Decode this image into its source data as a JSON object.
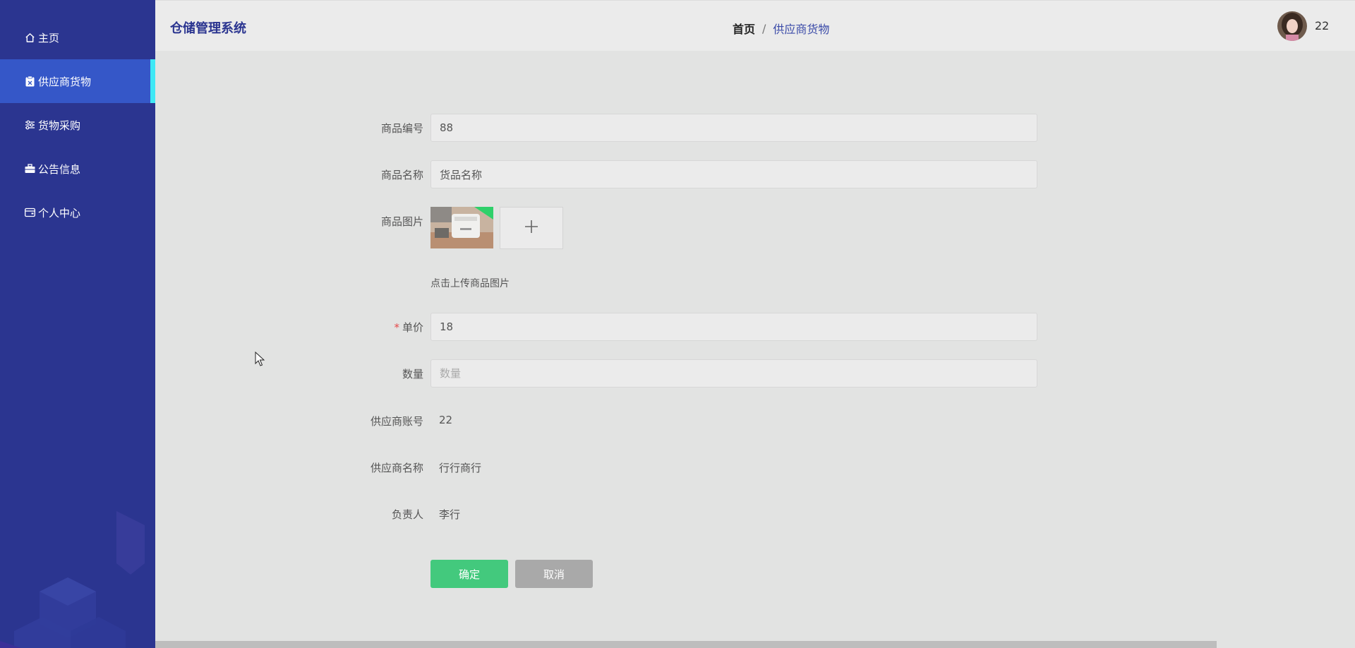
{
  "app": {
    "title": "仓储管理系统"
  },
  "sidebar": {
    "items": [
      {
        "label": "主页",
        "icon": "home-icon",
        "active": false
      },
      {
        "label": "供应商货物",
        "icon": "clipboard-icon",
        "active": true
      },
      {
        "label": "货物采购",
        "icon": "sliders-icon",
        "active": false
      },
      {
        "label": "公告信息",
        "icon": "briefcase-icon",
        "active": false
      },
      {
        "label": "个人中心",
        "icon": "wallet-icon",
        "active": false
      }
    ]
  },
  "header": {
    "breadcrumb": {
      "home": "首页",
      "separator": "/",
      "current": "供应商货物"
    },
    "user": {
      "name": "22"
    }
  },
  "form": {
    "product_no": {
      "label": "商品编号",
      "value": "88"
    },
    "product_name": {
      "label": "商品名称",
      "value": "货品名称"
    },
    "product_image": {
      "label": "商品图片",
      "hint": "点击上传商品图片",
      "upload_icon": "plus-icon"
    },
    "unit_price": {
      "label": "单价",
      "required_mark": "*",
      "value": "18"
    },
    "quantity": {
      "label": "数量",
      "value": "",
      "placeholder": "数量"
    },
    "supplier_account": {
      "label": "供应商账号",
      "value": "22"
    },
    "supplier_name": {
      "label": "供应商名称",
      "value": "行行商行"
    },
    "manager": {
      "label": "负责人",
      "value": "李行"
    },
    "buttons": {
      "confirm": "确定",
      "cancel": "取消"
    }
  },
  "colors": {
    "sidebar_bg": "#2b3590",
    "sidebar_active": "#3557c8",
    "active_indicator": "#3fe8f5",
    "confirm_button": "#43c97d",
    "cancel_button": "#a9a9a9",
    "required_star": "#e64a4a"
  }
}
